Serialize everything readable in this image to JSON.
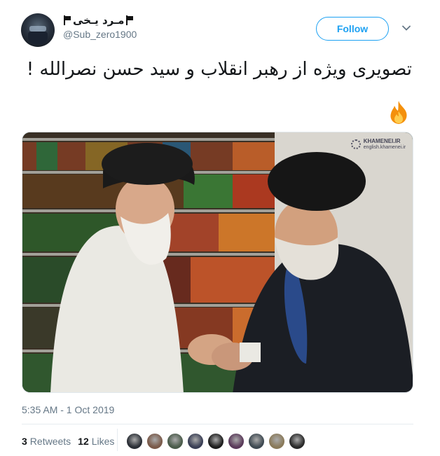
{
  "tweet": {
    "display_name": "مـرد يـخی",
    "handle": "@Sub_zero1900",
    "follow_label": "Follow",
    "text": "تصویری ویژه از رهبر انقلاب و سید حسن نصرالله !",
    "timestamp": "5:35 AM - 1 Oct 2019",
    "photo_watermark": {
      "title": "KHAMENEI.IR",
      "subtitle": "english.khamenei.ir"
    }
  },
  "stats": {
    "retweets_count": "3",
    "retweets_label": "Retweets",
    "likes_count": "12",
    "likes_label": "Likes"
  },
  "likers": [
    {
      "icon": "avatar-1",
      "color": "#2b2f36"
    },
    {
      "icon": "avatar-2",
      "color": "#7a5a4a"
    },
    {
      "icon": "avatar-3",
      "color": "#4a5b4a"
    },
    {
      "icon": "avatar-4",
      "color": "#3a3f55"
    },
    {
      "icon": "avatar-5",
      "color": "#1e1e1e"
    },
    {
      "icon": "avatar-6",
      "color": "#5a3a5a"
    },
    {
      "icon": "avatar-7",
      "color": "#3f4a52"
    },
    {
      "icon": "avatar-8",
      "color": "#8a7a5a"
    },
    {
      "icon": "avatar-9",
      "color": "#2a2a2a"
    }
  ],
  "colors": {
    "accent": "#1da1f2",
    "muted": "#657786",
    "text": "#14171a"
  }
}
